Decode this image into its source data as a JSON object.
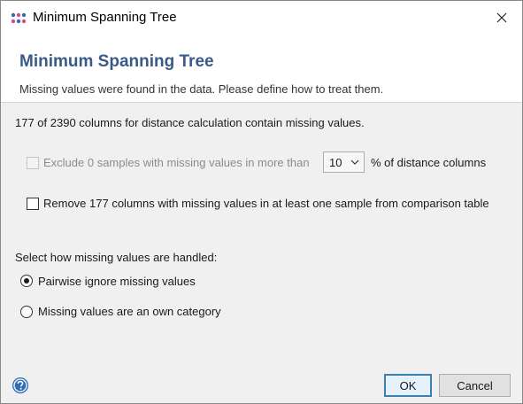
{
  "window": {
    "title": "Minimum Spanning Tree"
  },
  "header": {
    "title": "Minimum Spanning Tree",
    "description": "Missing values were found in the data. Please define how to treat them."
  },
  "info": "177 of 2390 columns for distance calculation contain missing values.",
  "exclude_option": {
    "label": "Exclude 0 samples with missing values in more than",
    "checked": false,
    "enabled": false,
    "percent_value": "10",
    "suffix": "% of distance columns"
  },
  "remove_option": {
    "label": "Remove 177 columns with missing values in at least one sample from comparison table",
    "checked": false
  },
  "missing_handling": {
    "heading": "Select how missing values are handled:",
    "options": [
      {
        "label": "Pairwise ignore missing values",
        "selected": true
      },
      {
        "label": "Missing values are an own category",
        "selected": false
      }
    ]
  },
  "buttons": {
    "ok": "OK",
    "cancel": "Cancel"
  },
  "icons": {
    "app": "app-dots-icon",
    "close": "close-icon",
    "help": "help-icon",
    "chevron": "chevron-down-icon"
  },
  "colors": {
    "header_title": "#3a5a88",
    "primary_border": "#3c7fb1",
    "help_icon": "#2f6eb5"
  }
}
